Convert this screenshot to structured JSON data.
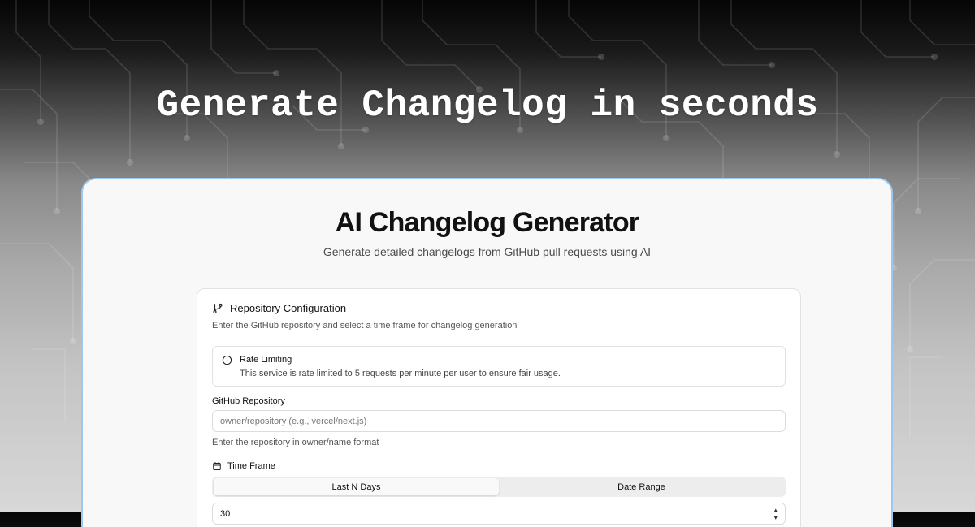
{
  "hero": {
    "headline": "Generate Changelog in seconds"
  },
  "app": {
    "title": "AI Changelog Generator",
    "subtitle": "Generate detailed changelogs from GitHub pull requests using AI"
  },
  "config_card": {
    "icon": "git-branch-icon",
    "title": "Repository Configuration",
    "description": "Enter the GitHub repository and select a time frame for changelog generation",
    "alert": {
      "icon": "info-icon",
      "title": "Rate Limiting",
      "text": "This service is rate limited to 5 requests per minute per user to ensure fair usage."
    },
    "repo_field": {
      "label": "GitHub Repository",
      "placeholder": "owner/repository (e.g., vercel/next.js)",
      "value": "",
      "hint": "Enter the repository in owner/name format"
    },
    "time_frame": {
      "icon": "calendar-icon",
      "label": "Time Frame",
      "tabs": [
        {
          "label": "Last N Days",
          "active": true
        },
        {
          "label": "Date Range",
          "active": false
        }
      ],
      "days_value": "30"
    }
  },
  "colors": {
    "window_border": "#9cc7ef",
    "window_bg": "#f8f8f8",
    "card_bg": "#ffffff",
    "headline": "#ffffff"
  }
}
